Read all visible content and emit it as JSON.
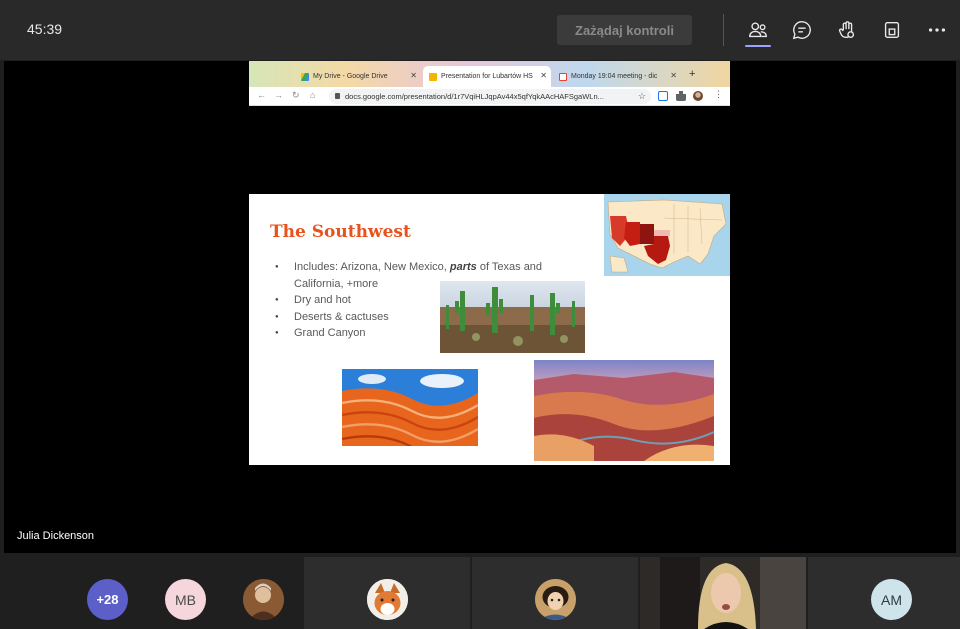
{
  "meeting": {
    "timer": "45:39",
    "request_control_label": "Zażądaj kontroli",
    "accent_color": "#9ea2ff"
  },
  "toolbar": {
    "icons": [
      "people-icon",
      "chat-icon",
      "raise-hand-icon",
      "share-tray-icon",
      "more-icon"
    ]
  },
  "browser": {
    "tabs": [
      {
        "label": "My Drive - Google Drive",
        "icon": "google-drive-icon"
      },
      {
        "label": "Presentation for Lubartów HS",
        "icon": "google-slides-icon"
      },
      {
        "label": "Monday 19:04 meeting - dic",
        "icon": "gmail-icon"
      }
    ],
    "url": "docs.google.com/presentation/d/1r7VqiHLJqpAv44x5qfYqkAAcHAFSgaWLn..."
  },
  "slide": {
    "title": "The Southwest",
    "bullets": [
      {
        "pre": "Includes: Arizona, New Mexico, ",
        "em": "parts",
        "post": " of Texas and California, +more"
      },
      {
        "pre": "Dry and hot",
        "em": "",
        "post": ""
      },
      {
        "pre": "Deserts & cactuses",
        "em": "",
        "post": ""
      },
      {
        "pre": "Grand Canyon",
        "em": "",
        "post": ""
      }
    ],
    "title_color": "#e8531d"
  },
  "speaker": {
    "name": "Julia Dickenson"
  },
  "gallery": {
    "overflow_count": "+28",
    "participants": [
      {
        "initials": "MB",
        "bg": "#f6d6dd",
        "fg": "#4a4a4a"
      },
      {
        "initials": "AM",
        "bg": "#cfe3ea",
        "fg": "#2d3b44"
      }
    ]
  }
}
